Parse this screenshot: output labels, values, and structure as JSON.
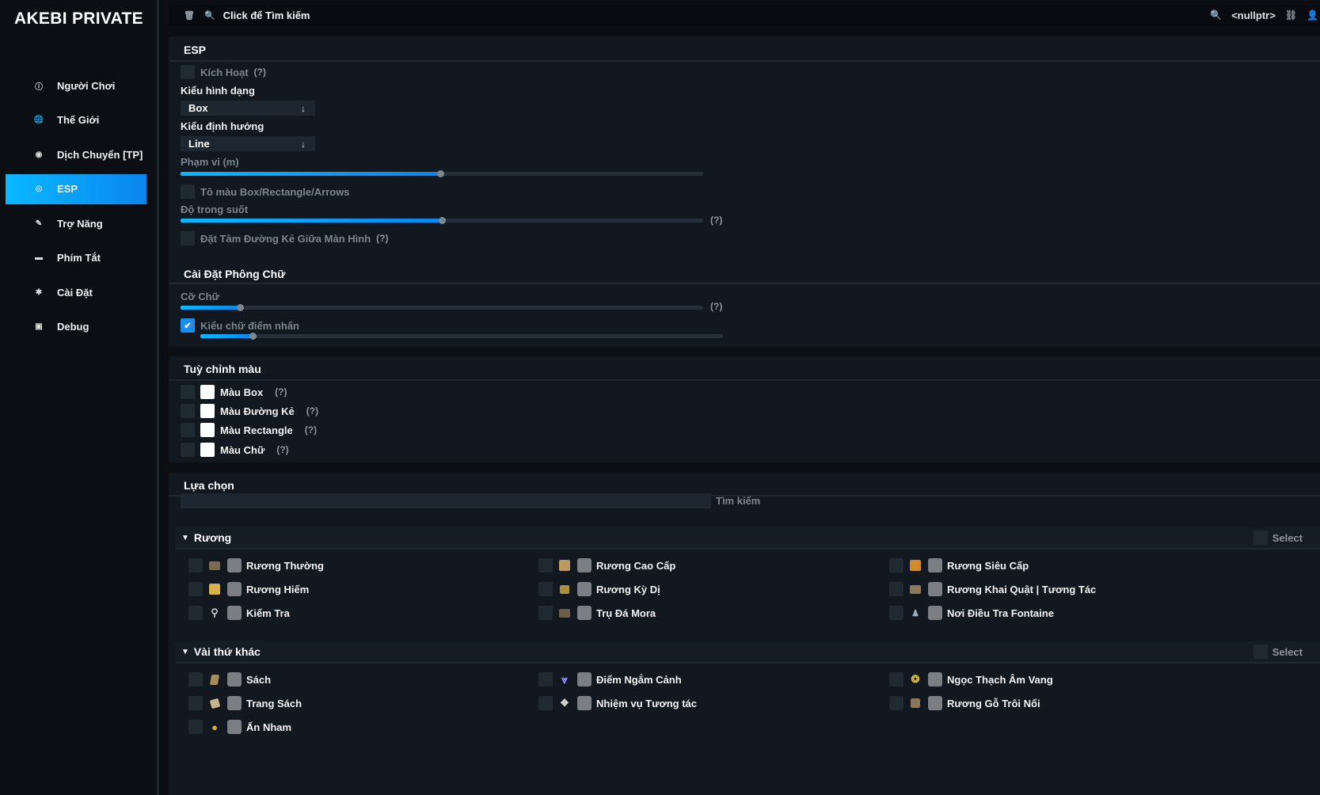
{
  "app": {
    "logo": "AKEBI PRIVATE"
  },
  "sidebar": {
    "items": [
      {
        "label": "Người Chơi",
        "icon": "info-icon"
      },
      {
        "label": "Thế Giới",
        "icon": "globe-icon"
      },
      {
        "label": "Dịch Chuyển [TP]",
        "icon": "compass-icon"
      },
      {
        "label": "ESP",
        "icon": "eye-icon",
        "active": true
      },
      {
        "label": "Trợ Năng",
        "icon": "brush-icon"
      },
      {
        "label": "Phím Tắt",
        "icon": "keyboard-icon"
      },
      {
        "label": "Cài Đặt",
        "icon": "gear-icon"
      },
      {
        "label": "Debug",
        "icon": "debug-icon"
      }
    ]
  },
  "topbar": {
    "search_hint": "Click để Tìm kiếm",
    "user": "<nullptr>"
  },
  "esp": {
    "title": "ESP",
    "enable_label": "Kích Hoạt",
    "help": "(?)",
    "shape_label": "Kiểu hình dạng",
    "shape_value": "Box",
    "direction_label": "Kiểu định hướng",
    "direction_value": "Line",
    "range_label": "Phạm vi (m)",
    "range_fraction": 0.497,
    "fill_label": "Tô màu Box/Rectangle/Arrows",
    "opacity_label": "Độ trong suốt",
    "opacity_fraction": 0.5,
    "center_label": "Đặt Tâm Đường Kẻ Giữa Màn Hình"
  },
  "font": {
    "title": "Cài Đặt Phông Chữ",
    "size_label": "Cỡ Chữ",
    "size_fraction": 0.113,
    "outline_label": "Kiểu chữ điểm nhấn",
    "outline_checked": true,
    "outline_fraction": 0.1
  },
  "colors": {
    "title": "Tuỳ chỉnh màu",
    "items": [
      {
        "label": "Màu Box",
        "color": "#ffffff"
      },
      {
        "label": "Màu Đường Kẻ",
        "color": "#ffffff"
      },
      {
        "label": "Màu Rectangle",
        "color": "#ffffff"
      },
      {
        "label": "Màu Chữ",
        "color": "#ffffff"
      }
    ]
  },
  "selection": {
    "title": "Lựa chọn",
    "search_label": "Tìm kiếm",
    "select_label": "Select",
    "groups": [
      {
        "title": "Rương",
        "items": [
          {
            "label": "Rương Thường",
            "icon": "common-chest-icon"
          },
          {
            "label": "Rương Cao Cấp",
            "icon": "exquisite-chest-icon"
          },
          {
            "label": "Rương Siêu Cấp",
            "icon": "precious-chest-icon"
          },
          {
            "label": "Rương Hiếm",
            "icon": "luxurious-chest-icon"
          },
          {
            "label": "Rương Kỳ Dị",
            "icon": "remarkable-chest-icon"
          },
          {
            "label": "Rương Khai Quật | Tương Tác",
            "icon": "excavated-chest-icon"
          },
          {
            "label": "Kiểm Tra",
            "icon": "magnifier-icon"
          },
          {
            "label": "Trụ Đá Mora",
            "icon": "mora-chest-icon"
          },
          {
            "label": "Nơi Điều Tra Fontaine",
            "icon": "fontaine-investigation-icon"
          }
        ]
      },
      {
        "title": "Vài thứ khác",
        "items": [
          {
            "label": "Sách",
            "icon": "book-icon"
          },
          {
            "label": "Điểm Ngắm Cảnh",
            "icon": "viewpoint-icon"
          },
          {
            "label": "Ngọc Thạch Âm Vang",
            "icon": "echoing-conch-icon"
          },
          {
            "label": "Trang Sách",
            "icon": "book-page-icon"
          },
          {
            "label": "Nhiệm vụ Tương tác",
            "icon": "quest-interaction-icon"
          },
          {
            "label": "Rương Gỗ Trôi Nổi",
            "icon": "floating-chest-icon"
          },
          {
            "label": "Ấn Nham",
            "icon": "geo-sigil-icon"
          }
        ]
      }
    ]
  }
}
